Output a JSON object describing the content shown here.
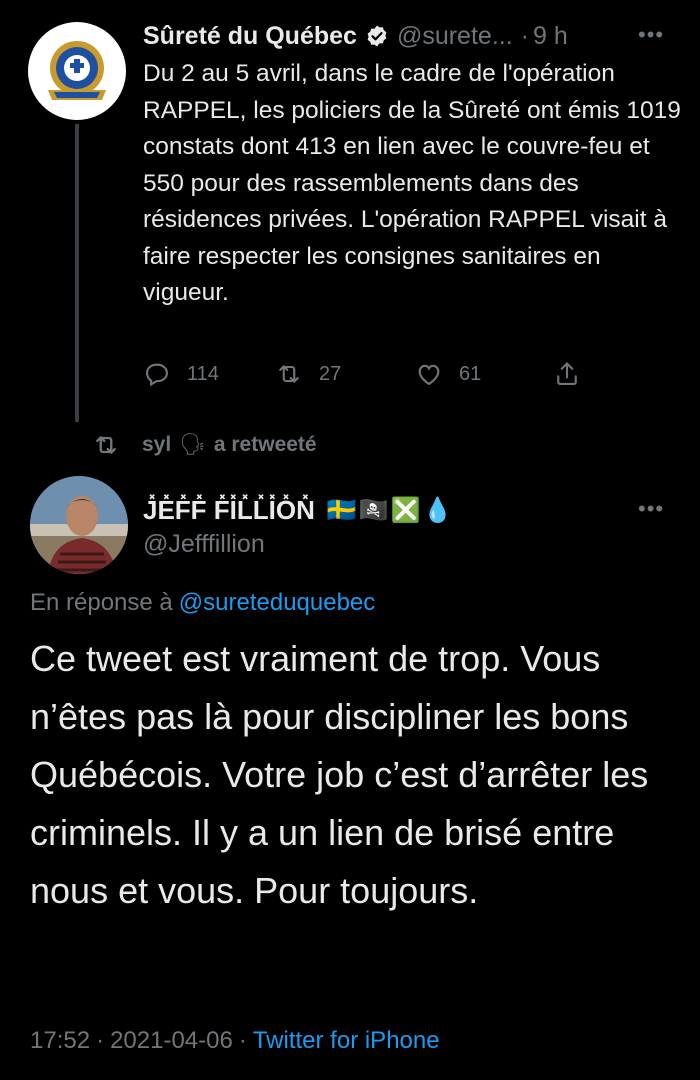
{
  "parent_tweet": {
    "author_name": "Sûreté du Québec",
    "handle": "@surete...",
    "time_sep": "·",
    "time": "9 h",
    "more_label": "•••",
    "avatar_icon": "police-badge-logo",
    "text": "Du 2 au 5 avril, dans le cadre de l'opération RAPPEL, les policiers de la Sûreté ont émis 1019 constats dont 413 en lien avec le couvre-feu et 550 pour des rassemblements dans des résidences privées. L'opération RAPPEL visait à faire respecter les consignes sanitaires en vigueur.",
    "actions": {
      "replies": "114",
      "retweets": "27",
      "likes": "61"
    }
  },
  "retweet_context": {
    "user": "syl",
    "emoji": "🗣",
    "label": "a retweeté"
  },
  "main_tweet": {
    "author_name": "J̽E̽F̽F̽ F̽I̽L̽L̽I̽O̽N̽",
    "author_emojis": "🇸🇪🏴‍☠️❎💧",
    "handle": "@Jefffillion",
    "more_label": "•••",
    "reply_prefix": "En réponse à",
    "reply_handle": "@sureteduquebec",
    "text": "Ce tweet est vraiment de trop. Vous n’êtes pas là pour discipliner les bons Québécois. Votre job c’est d’arrêter les criminels. Il y a un lien de brisé entre nous et vous. Pour toujours.",
    "time": "17:52",
    "date": "2021-04-06",
    "sep": "·",
    "source": "Twitter for iPhone"
  },
  "colors": {
    "background": "#000000",
    "text": "#e7e9ea",
    "muted": "#71767b",
    "link": "#1d9bf0"
  }
}
